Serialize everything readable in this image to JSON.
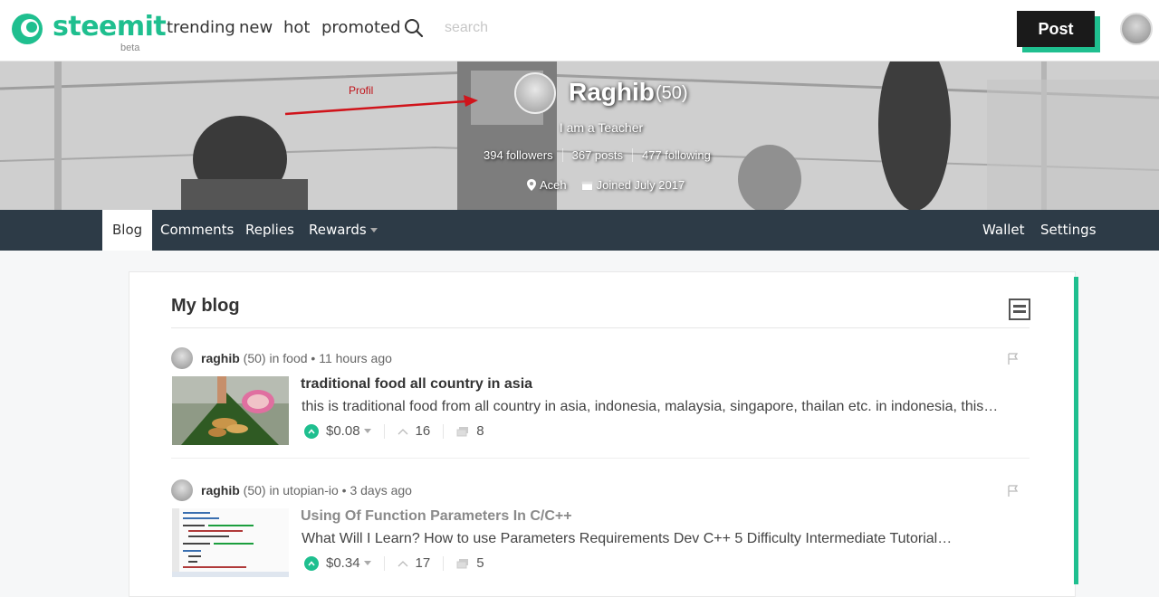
{
  "header": {
    "logo_text": "steemit",
    "logo_badge": "beta",
    "nav": [
      "trending",
      "new",
      "hot",
      "promoted"
    ],
    "search_placeholder": "search",
    "post_label": "Post"
  },
  "profile": {
    "name": "Raghib",
    "reputation": "(50)",
    "about": "I am a Teacher",
    "followers": "394 followers",
    "posts": "367 posts",
    "following": "477 following",
    "location": "Aceh",
    "joined": "Joined July 2017",
    "annotation": "Profil"
  },
  "tabs": {
    "blog": "Blog",
    "comments": "Comments",
    "replies": "Replies",
    "rewards": "Rewards",
    "wallet": "Wallet",
    "settings": "Settings"
  },
  "blog": {
    "title": "My blog",
    "posts": [
      {
        "author": "raghib",
        "author_rep": "(50)",
        "category_prefix": "in",
        "category": "food",
        "time": "11 hours ago",
        "title": "traditional food all country in asia",
        "excerpt": "this is traditional food from all country in asia, indonesia, malaysia, singapore, thailan etc. in indonesia, this…",
        "payout": "$0.08",
        "votes": "16",
        "comments": "8"
      },
      {
        "author": "raghib",
        "author_rep": "(50)",
        "category_prefix": "in",
        "category": "utopian-io",
        "time": "3 days ago",
        "title": "Using Of Function Parameters In C/C++",
        "excerpt": "What Will I Learn? How to use Parameters Requirements Dev C++ 5 Difficulty Intermediate Tutorial…",
        "payout": "$0.34",
        "votes": "17",
        "comments": "5"
      }
    ]
  },
  "colors": {
    "brand": "#1fbf8f",
    "nav_bg": "#2d3b47",
    "annotation": "#c0141b"
  }
}
